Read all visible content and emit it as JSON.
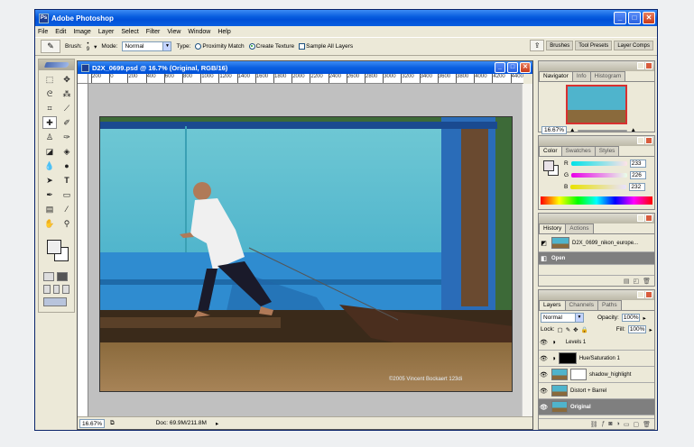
{
  "app": {
    "title": "Adobe Photoshop"
  },
  "menu": [
    "File",
    "Edit",
    "Image",
    "Layer",
    "Select",
    "Filter",
    "View",
    "Window",
    "Help"
  ],
  "options": {
    "brush_label": "Brush:",
    "brush_size": "9",
    "mode_label": "Mode:",
    "mode_value": "Normal",
    "type_label": "Type:",
    "radio1": "Proximity Match",
    "radio2": "Create Texture",
    "checkbox": "Sample All Layers",
    "well_tabs": [
      "Brushes",
      "Tool Presets",
      "Layer Comps"
    ]
  },
  "document": {
    "title": "D2X_0699.psd @ 16.7% (Original, RGB/16)",
    "zoom": "16.67%",
    "doc_info": "Doc: 69.9M/211.8M",
    "watermark": "©2005 Vincent Bockaert  123di",
    "ruler_marks": [
      "200",
      "0",
      "200",
      "400",
      "600",
      "800",
      "1000",
      "1200",
      "1400",
      "1600",
      "1800",
      "2000",
      "2200",
      "2400",
      "2600",
      "2800",
      "3000",
      "3200",
      "3400",
      "3600",
      "3800",
      "4000",
      "4200",
      "4400"
    ]
  },
  "navigator": {
    "tabs": [
      "Navigator",
      "Info",
      "Histogram"
    ],
    "zoom": "16.67%"
  },
  "color": {
    "tabs": [
      "Color",
      "Swatches",
      "Styles"
    ],
    "r_label": "R",
    "g_label": "G",
    "b_label": "B",
    "r": "233",
    "g": "226",
    "b": "232"
  },
  "history": {
    "tabs": [
      "History",
      "Actions"
    ],
    "snapshot": "D2X_0699_nikon_europe...",
    "step": "Open"
  },
  "layers": {
    "tabs": [
      "Layers",
      "Channels",
      "Paths"
    ],
    "blend": "Normal",
    "opacity_label": "Opacity:",
    "opacity": "100%",
    "lock_label": "Lock:",
    "fill_label": "Fill:",
    "fill": "100%",
    "items": [
      {
        "name": "Levels 1"
      },
      {
        "name": "Hue/Saturation 1"
      },
      {
        "name": "shadow_highlight"
      },
      {
        "name": "Distort + Barrel"
      },
      {
        "name": "Original"
      }
    ]
  }
}
